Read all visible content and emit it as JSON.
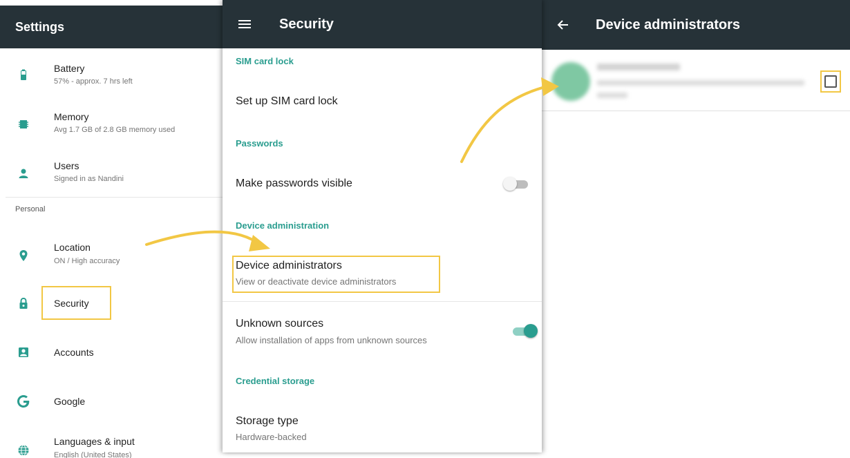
{
  "settings": {
    "title": "Settings",
    "items": [
      {
        "title": "Battery",
        "subtitle": "57% - approx. 7 hrs left",
        "icon": "battery-icon"
      },
      {
        "title": "Memory",
        "subtitle": "Avg 1.7 GB of 2.8 GB memory used",
        "icon": "memory-icon"
      },
      {
        "title": "Users",
        "subtitle": "Signed in as Nandini",
        "icon": "person-icon"
      }
    ],
    "section_personal": "Personal",
    "personal_items": [
      {
        "title": "Location",
        "subtitle": "ON / High accuracy",
        "icon": "location-pin-icon"
      },
      {
        "title": "Security",
        "icon": "lock-icon"
      },
      {
        "title": "Accounts",
        "icon": "account-box-icon"
      },
      {
        "title": "Google",
        "icon": "google-g-icon"
      },
      {
        "title": "Languages & input",
        "subtitle": "English (United States)",
        "icon": "globe-icon"
      }
    ]
  },
  "security": {
    "title": "Security",
    "sim_category": "SIM card lock",
    "sim_item": "Set up SIM card lock",
    "passwords_category": "Passwords",
    "passwords_item": "Make passwords visible",
    "passwords_visible": false,
    "device_admin_category": "Device administration",
    "device_admin_title": "Device administrators",
    "device_admin_sub": "View or deactivate device administrators",
    "unknown_title": "Unknown sources",
    "unknown_sub": "Allow installation of apps from unknown sources",
    "unknown_enabled": true,
    "credential_category": "Credential storage",
    "storage_title": "Storage type",
    "storage_sub": "Hardware-backed"
  },
  "device_admins": {
    "title": "Device administrators",
    "admin_checked": false
  },
  "colors": {
    "app_bar": "#263238",
    "accent": "#2a9d8f",
    "highlight": "#f2c744",
    "arrow": "#f2c744"
  }
}
